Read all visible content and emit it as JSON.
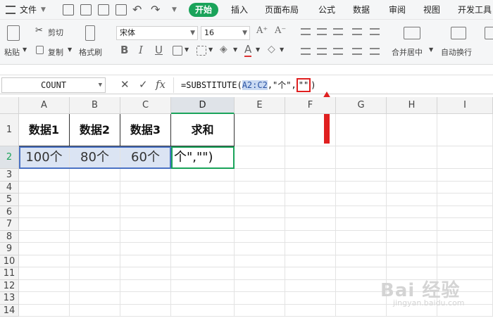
{
  "menubar": {
    "file_label": "文件",
    "tabs": [
      "开始",
      "插入",
      "页面布局",
      "公式",
      "数据",
      "审阅",
      "视图",
      "开发工具"
    ],
    "active_tab": "开始"
  },
  "toolbar": {
    "paste_label": "粘贴",
    "cut_label": "剪切",
    "copy_label": "复制",
    "format_painter_label": "格式刷",
    "font_name": "宋体",
    "font_size": "16",
    "merge_label": "合并居中",
    "wrap_label": "自动换行",
    "bold_glyph": "B",
    "italic_glyph": "I",
    "underline_glyph": "U",
    "grow_font": "A⁺",
    "shrink_font": "A⁻"
  },
  "formula_bar": {
    "name_box": "COUNT",
    "cancel_glyph": "✕",
    "confirm_glyph": "✓",
    "fx_label": "fx",
    "formula_prefix": "=SUBSTITUTE(",
    "formula_ref": "A2:C2",
    "formula_mid": ",\"个\",",
    "formula_boxed": "\"\"",
    "formula_suffix": ")"
  },
  "sheet": {
    "columns": [
      "A",
      "B",
      "C",
      "D",
      "E",
      "F",
      "G",
      "H",
      "I"
    ],
    "rows": [
      "1",
      "2",
      "3",
      "4",
      "5",
      "6",
      "7",
      "8",
      "9",
      "10",
      "11",
      "12",
      "13",
      "14"
    ],
    "header_row": [
      "数据1",
      "数据2",
      "数据3",
      "求和"
    ],
    "data_row": [
      "100个",
      "80个",
      "60个"
    ],
    "editing_text": "个\",\"\")"
  },
  "watermark": {
    "text": "Bai 经验",
    "url": "jingyan.baidu.com"
  },
  "colors": {
    "accent_green": "#1aa35a",
    "selection_blue": "#4a72c4",
    "highlight_red": "#e02020"
  }
}
